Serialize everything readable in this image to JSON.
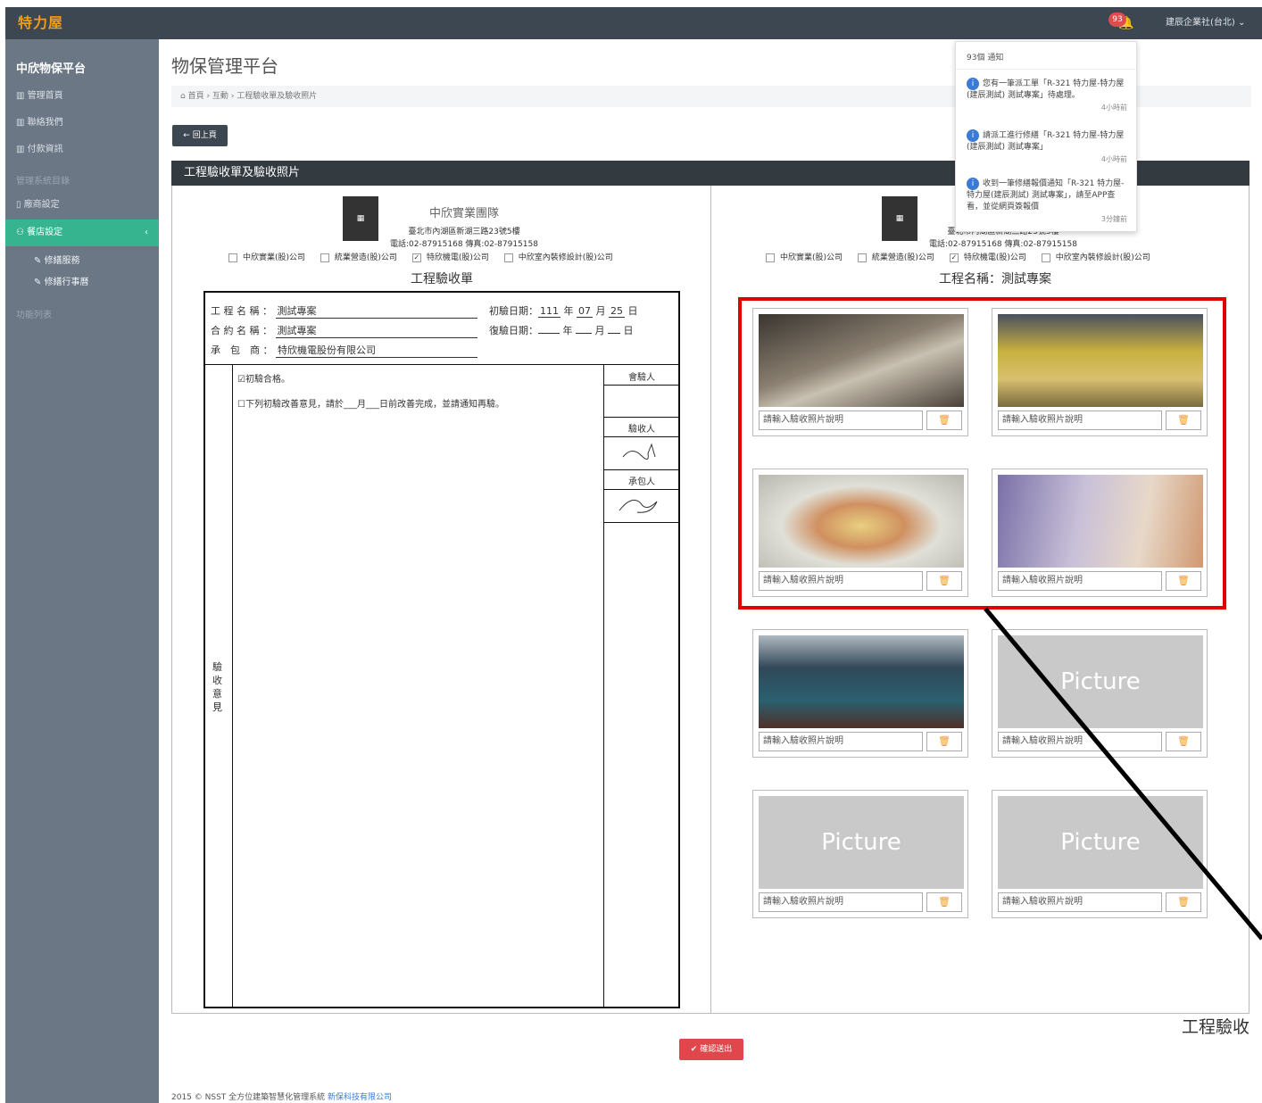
{
  "topbar": {
    "logo": "特力屋",
    "badge": "93",
    "user": "建辰企業社(台北) ⌄"
  },
  "sidebar": {
    "title": "中欣物保平台",
    "items": [
      "管理首頁",
      "聯絡我們",
      "付款資訊"
    ],
    "section1": "管理系統目錄",
    "item_vendor": "廠商設定",
    "active": "餐店設定",
    "sub": [
      "修繕服務",
      "修繕行事曆"
    ],
    "section2": "功能列表"
  },
  "page": {
    "title": "物保管理平台",
    "breadcrumb": "首頁 › 互動 › 工程驗收單及驗收照片",
    "back": "回上頁",
    "panel_title": "工程驗收單及驗收照片"
  },
  "company": {
    "name": "中欣實業團隊",
    "address": "臺北市內湖區新湖三路23號5樓",
    "phone": "電話:02-87915168  傳真:02-87915158",
    "options": [
      "中欣實業(股)公司",
      "統業營造(股)公司",
      "特欣機電(股)公司",
      "中欣室內裝修設計(股)公司"
    ]
  },
  "form": {
    "title": "工程驗收單",
    "proj_label": "工 程 名 稱 ：",
    "proj": "測試專案",
    "contract_label": "合 約 名 稱 ：",
    "contract": "測試專案",
    "contractor_label": "承　包　商 ：",
    "contractor": "特欣機電股份有限公司",
    "first_date_label": "初驗日期：",
    "yy": "111",
    "mm": "07",
    "dd": "25",
    "re_date_label": "復驗日期：",
    "year": "年",
    "month": "月",
    "day": "日",
    "pass": "☑初驗合格。",
    "improve": "☐下列初驗改善意見，請於___月___日前改善完成，並請通知再驗。",
    "check_person": "會驗人",
    "acceptor": "驗收人",
    "contractor_sig": "承包人",
    "vert": "驗收意見"
  },
  "right": {
    "project_title": "工程名稱：測試專案"
  },
  "photos": {
    "placeholder": "請輸入驗收照片說明",
    "empty": "Picture"
  },
  "notifications": {
    "header": "93個 通知",
    "items": [
      {
        "text": "您有一筆派工單「R-321 特力屋-特力屋(建辰測試) 測試專案」待處理。",
        "time": "4小時前"
      },
      {
        "text": "請派工進行修繕「R-321 特力屋-特力屋(建辰測試) 測試專案」",
        "time": "4小時前"
      },
      {
        "text": "收到一筆修繕報價通知「R-321 特力屋-特力屋(建辰測試) 測試專案」，請至APP查看，並從網頁簽報價",
        "time": "3分鐘前"
      }
    ]
  },
  "submit": "確認送出",
  "footer": {
    "text": "2015 © NSST 全方位建築智慧化管理系統 ",
    "link": "新保科技有限公司"
  },
  "overlay_label": "工程驗收"
}
